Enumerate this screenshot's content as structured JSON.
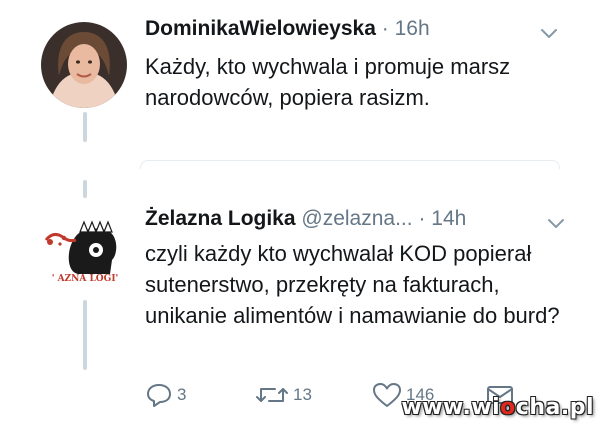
{
  "thread": [
    {
      "name": "DominikaWielowieyska",
      "handle": "",
      "separator": "·",
      "time": "16h",
      "text": "Każdy, kto wychwala i promuje marsz narodowców, popiera rasizm.",
      "avatar_icon": "woman-portrait-avatar"
    },
    {
      "name": "Żelazna Logika",
      "handle": "@zelazna...",
      "separator": "·",
      "time": "14h",
      "text": "czyli każdy kto wychwalał KOD popierał sutenerstwo, przekręty na fakturach, unikanie alimentów i namawianie do burd?",
      "avatar_icon": "zelazna-logika-logo-avatar",
      "avatar_caption": "' AZNA LOGI'",
      "actions": {
        "reply_count": "3",
        "retweet_count": "13",
        "like_count": "146",
        "reply_icon": "reply-icon",
        "retweet_icon": "retweet-icon",
        "like_icon": "heart-icon",
        "dm_icon": "envelope-icon"
      }
    }
  ],
  "watermark": {
    "prefix": "www.wi",
    "accent": "o",
    "suffix": "cha.pl"
  },
  "colors": {
    "text": "#14171a",
    "secondary": "#657786",
    "thread_line": "#ccd6dd",
    "divider": "#e6ecf0",
    "watermark_accent": "#e0281e"
  }
}
